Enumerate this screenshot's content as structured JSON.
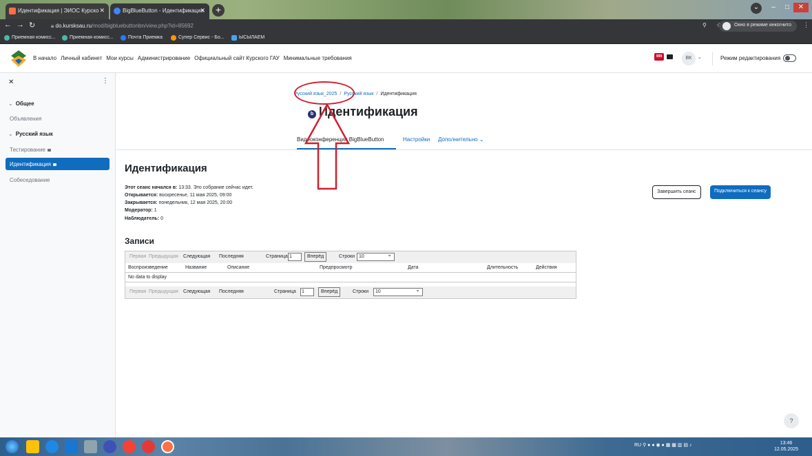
{
  "browser": {
    "tabs": [
      {
        "title": "Идентификация | ЭИОС Курско",
        "color": "#ff7043"
      },
      {
        "title": "BigBlueButton - Идентификация",
        "color": "#4285f4"
      }
    ],
    "url_host": "do.kursksau.ru",
    "url_path": "/mod/bigbluebuttonbn/view.php?id=85692",
    "incognito": "Окно в режиме инкогнито",
    "bookmarks": [
      {
        "label": "Приемная комисс...",
        "color": "#4db6ac"
      },
      {
        "label": "Приемная комисс...",
        "color": "#4db6ac"
      },
      {
        "label": "Почта Приемка",
        "color": "#2979ff"
      },
      {
        "label": "Супер Сервис - Бо...",
        "color": "#ff9800"
      },
      {
        "label": "ЫСЫЛАЕМ",
        "color": "#42a5f5"
      }
    ]
  },
  "navbar": {
    "links": [
      "В начало",
      "Личный кабинет",
      "Мои курсы",
      "Администрирование",
      "Официальный сайт Курского ГАУ",
      "Минимальные требования"
    ],
    "avatar": "ВК",
    "edit_mode": "Режим редактирования",
    "accent": "#0f6cbf"
  },
  "drawer": {
    "sections": [
      {
        "title": "Общее",
        "items": [
          "Объявления"
        ]
      },
      {
        "title": "Русский язык",
        "items": [
          "Тестирование",
          "Идентификация",
          "Собеседование"
        ]
      }
    ]
  },
  "main": {
    "breadcrumb": [
      "Русский язык_2025",
      "Русский язык",
      "Идентификация"
    ],
    "title": "Идентификация",
    "tabs": [
      "Видеоконференция BigBlueButton",
      "Настройки",
      "Дополнительно"
    ],
    "heading": "Идентификация",
    "info": [
      {
        "label": "Этот сеанс начался в:",
        "value": " 13:33. Это собрание сейчас идет."
      },
      {
        "label": "Открывается:",
        "value": " воскресенье, 11 мая 2025, 09:00"
      },
      {
        "label": "Закрывается:",
        "value": " понедельник, 12 мая 2025, 20:00"
      },
      {
        "label": "Модератор:",
        "value": " 1"
      },
      {
        "label": "Наблюдатель:",
        "value": " 0"
      }
    ],
    "btn_end": "Завершить сеанс",
    "btn_join": "Подключиться к сеансу",
    "records_title": "Записи",
    "pager": {
      "first": "Первая",
      "prev": "Предыдущая",
      "next": "Следующая",
      "last": "Последняя",
      "page_label": "Страница",
      "page_value": "1",
      "go": "Вперёд",
      "rows_label": "Строки",
      "rows_value": "10"
    },
    "columns": [
      "Воспроизведение",
      "Название",
      "Описание",
      "Предпросмотр",
      "Дата",
      "Длительность",
      "Действия"
    ],
    "empty": "No data to display"
  },
  "taskbar": {
    "lang": "RU",
    "time": "13:46",
    "date": "12.05.2025"
  }
}
